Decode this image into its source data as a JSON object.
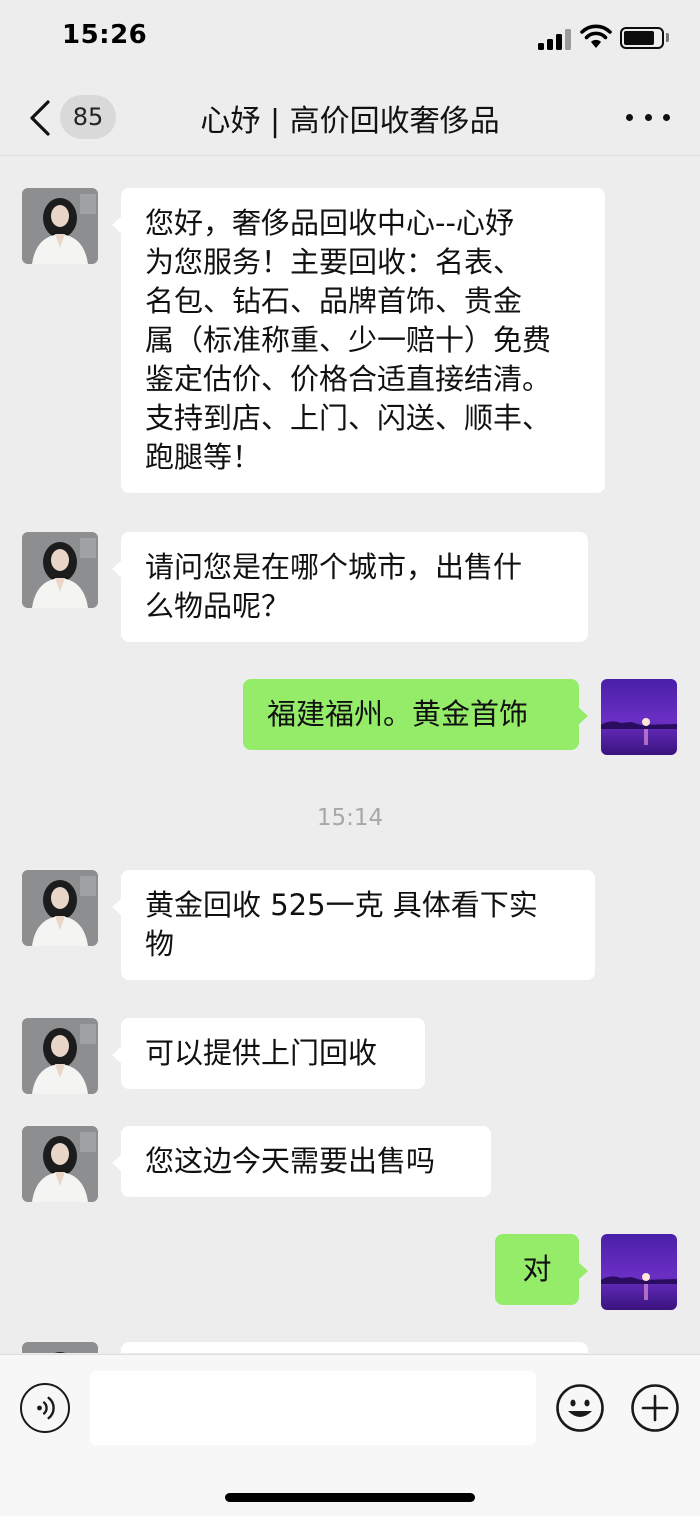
{
  "status_bar": {
    "time": "15:26",
    "icons": [
      "cellular-signal-icon",
      "wifi-icon",
      "battery-icon"
    ]
  },
  "nav": {
    "back_icon": "chevron-left-icon",
    "unread_count": "85",
    "title": "心妤 | 高价回收奢侈品",
    "more_icon": "more-dots-icon"
  },
  "messages": [
    {
      "side": "in",
      "lines": [
        "您好，奢侈品回收中心--心妤",
        "为您服务！主要回收：名表、",
        "名包、钻石、品牌首饰、贵金",
        "属（标准称重、少一赔十）免费",
        "鉴定估价、价格合适直接结清。",
        "支持到店、上门、闪送、顺丰、",
        "跑腿等！"
      ]
    },
    {
      "side": "in",
      "lines": [
        "请问您是在哪个城市，出售什",
        "么物品呢？"
      ]
    },
    {
      "side": "out",
      "lines": [
        "福建福州。黄金首饰"
      ]
    },
    {
      "side": "in",
      "lines": [
        "黄金回收 525一克 具体看下实",
        "物"
      ]
    },
    {
      "side": "in",
      "lines": [
        "可以提供上门回收"
      ]
    },
    {
      "side": "in",
      "lines": [
        "您这边今天需要出售吗"
      ]
    },
    {
      "side": "out",
      "lines": [
        "对"
      ]
    }
  ],
  "time_separator": "15:14",
  "input_bar": {
    "voice_icon": "voice-icon",
    "text_value": "",
    "emoji_icon": "emoji-icon",
    "plus_icon": "plus-icon"
  },
  "colors": {
    "background": "#ededed",
    "incoming_bubble": "#ffffff",
    "outgoing_bubble": "#95ec69",
    "time_text": "#a8a8a8"
  }
}
